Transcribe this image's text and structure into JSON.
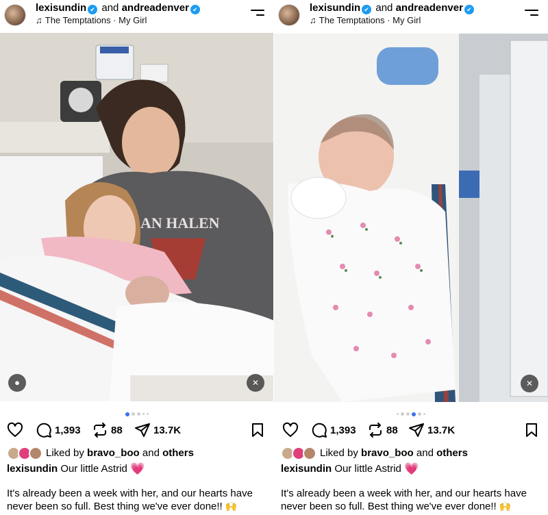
{
  "posts": [
    {
      "header": {
        "user1": "lexisundin",
        "conj": "and",
        "user2": "andreadenver",
        "verified": "✔",
        "song": "The Temptations · My Girl"
      },
      "actions": {
        "comments": "1,393",
        "reposts": "88",
        "shares": "13.7K"
      },
      "liked": {
        "prefix": "Liked by",
        "user": "bravo_boo",
        "mid": "and",
        "others": "others"
      },
      "caption": {
        "user": "lexisundin",
        "text": "Our little Astrid",
        "emoji": "💗"
      },
      "body": {
        "text": "It's already been a week with her, and our hearts have never been so full. Best thing we've ever done!!",
        "emoji": "🙌"
      },
      "carousel": {
        "active_index": 0,
        "total": 5
      }
    },
    {
      "header": {
        "user1": "lexisundin",
        "conj": "and",
        "user2": "andreadenver",
        "verified": "✔",
        "song": "The Temptations · My Girl"
      },
      "actions": {
        "comments": "1,393",
        "reposts": "88",
        "shares": "13.7K"
      },
      "liked": {
        "prefix": "Liked by",
        "user": "bravo_boo",
        "mid": "and",
        "others": "others"
      },
      "caption": {
        "user": "lexisundin",
        "text": "Our little Astrid",
        "emoji": "💗"
      },
      "body": {
        "text": "It's already been a week with her, and our hearts have never been so full. Best thing we've ever done!!",
        "emoji": "🙌"
      },
      "carousel": {
        "active_index": 3,
        "total": 6
      }
    }
  ],
  "icons": {
    "menu": "menu-icon",
    "like": "heart-icon",
    "comment": "comment-icon",
    "repost": "repost-icon",
    "share": "share-icon",
    "save": "bookmark-icon",
    "mute": "mute-icon",
    "tag": "user-tag-icon",
    "music": "music-note-icon"
  },
  "colors": {
    "verified": "#1d9bf0",
    "active_dot": "#3a6ff0",
    "heart_emoji": "#e6007e"
  }
}
